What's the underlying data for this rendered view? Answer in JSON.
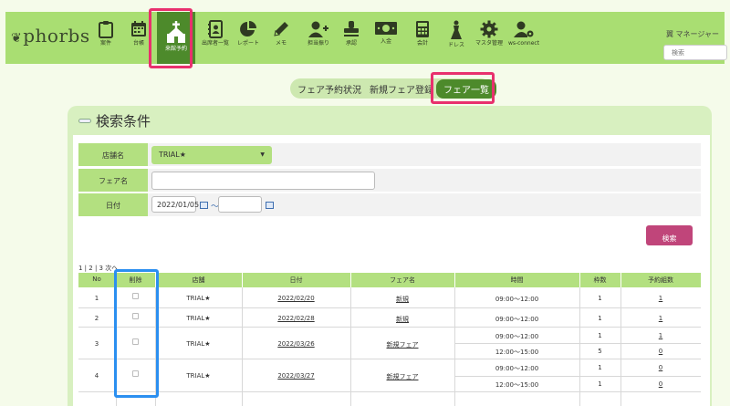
{
  "header": {
    "logo_text": "phorbs",
    "manager": "翼 マネージャー",
    "search_placeholder": "検索",
    "nav": [
      {
        "label": "案件",
        "icon": "clipboard-icon"
      },
      {
        "label": "台帳",
        "icon": "calendar-icon"
      },
      {
        "label": "来館予約",
        "icon": "chapel-icon",
        "active": true
      },
      {
        "label": "出席者一覧",
        "icon": "contact-book-icon"
      },
      {
        "label": "レポート",
        "icon": "pie-chart-icon"
      },
      {
        "label": "メモ",
        "icon": "pencil-icon"
      },
      {
        "label": "担当振り",
        "icon": "add-user-icon"
      },
      {
        "label": "承認",
        "icon": "stamp-icon"
      },
      {
        "label": "入金",
        "icon": "money-icon"
      },
      {
        "label": "会計",
        "icon": "calculator-icon"
      },
      {
        "label": "ドレス",
        "icon": "dress-icon"
      },
      {
        "label": "マスタ管理",
        "icon": "gear-icon"
      },
      {
        "label": "ws-connect",
        "icon": "user-gear-icon"
      }
    ]
  },
  "subtabs": [
    "フェア予約状況",
    "新規フェア登録",
    "フェア一覧"
  ],
  "search_panel": {
    "title": "検索条件",
    "store_label": "店舗名",
    "store_value": "TRIAL★",
    "fair_label": "フェア名",
    "fair_value": "",
    "date_label": "日付",
    "date_from": "2022/01/05",
    "date_sep": "〜",
    "date_to": "",
    "search_button": "検索"
  },
  "pager": "1 | 2 | 3 次へ",
  "table": {
    "headers": [
      "No",
      "削除",
      "店舗",
      "日付",
      "フェア名",
      "時間",
      "枠数",
      "予約組数"
    ],
    "rows": [
      {
        "no": "1",
        "store": "TRIAL★",
        "date": "2022/02/20",
        "fair": "新規",
        "slots": [
          {
            "time": "09:00〜12:00",
            "count": "1",
            "reserved": "1"
          }
        ]
      },
      {
        "no": "2",
        "store": "TRIAL★",
        "date": "2022/02/28",
        "fair": "新規",
        "slots": [
          {
            "time": "09:00〜12:00",
            "count": "1",
            "reserved": "1"
          }
        ]
      },
      {
        "no": "3",
        "store": "TRIAL★",
        "date": "2022/03/26",
        "fair": "新規フェア",
        "slots": [
          {
            "time": "09:00〜12:00",
            "count": "1",
            "reserved": "1"
          },
          {
            "time": "12:00〜15:00",
            "count": "5",
            "reserved": "0"
          }
        ]
      },
      {
        "no": "4",
        "store": "TRIAL★",
        "date": "2022/03/27",
        "fair": "新規フェア",
        "slots": [
          {
            "time": "09:00〜12:00",
            "count": "1",
            "reserved": "0"
          },
          {
            "time": "12:00〜15:00",
            "count": "1",
            "reserved": "0"
          }
        ]
      }
    ]
  }
}
